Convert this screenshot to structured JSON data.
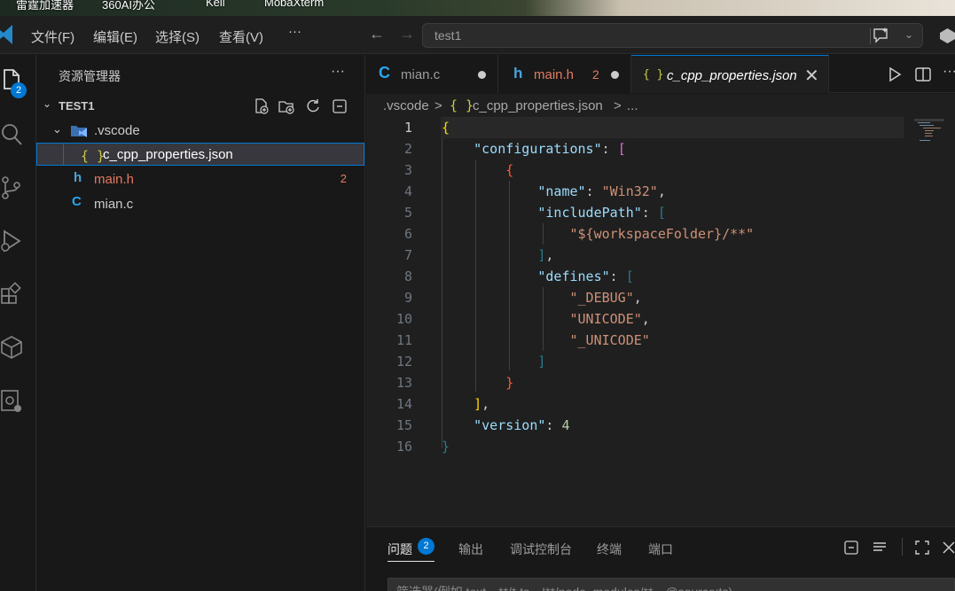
{
  "desktop": {
    "icons": [
      "雷霆加速器",
      "360AI办公",
      "Keil",
      "MobaXterm"
    ]
  },
  "menu": {
    "items": [
      "文件(F)",
      "编辑(E)",
      "选择(S)",
      "查看(V)",
      "···"
    ]
  },
  "command_center": {
    "text": "test1"
  },
  "activity_bar": {
    "explorer_badge": "2",
    "icons": [
      "files-icon",
      "search-icon",
      "source-control-icon",
      "run-debug-icon",
      "extensions-icon",
      "remote-explorer-icon",
      "settings-sync-icon"
    ]
  },
  "sidebar": {
    "title": "资源管理器",
    "more": "···",
    "section": "TEST1",
    "tree": [
      {
        "icon": "vscode-folder-icon",
        "label": ".vscode",
        "expanded": true
      },
      {
        "icon": "json-icon",
        "glyph": "{ }",
        "label": "c_cpp_properties.json",
        "selected": true
      },
      {
        "icon": "h-file-icon",
        "glyph": "h",
        "label": "main.h",
        "problems": "2"
      },
      {
        "icon": "c-file-icon",
        "glyph": "C",
        "label": "mian.c"
      }
    ]
  },
  "tabs": [
    {
      "glyph": "C",
      "label": "mian.c",
      "dirty": true
    },
    {
      "glyph": "h",
      "label": "main.h",
      "problems": "2",
      "dirty": true
    },
    {
      "glyph": "{ }",
      "label": "c_cpp_properties.json",
      "active": true,
      "close": "✕"
    }
  ],
  "breadcrumb": {
    "parts": [
      ".vscode",
      ">",
      "{ }",
      "c_cpp_properties.json",
      ">",
      "..."
    ]
  },
  "editor": {
    "line_numbers": [
      "1",
      "2",
      "3",
      "4",
      "5",
      "6",
      "7",
      "8",
      "9",
      "10",
      "11",
      "12",
      "13",
      "14",
      "15",
      "16"
    ],
    "current_line": 1
  },
  "panel": {
    "tabs": [
      "问题",
      "输出",
      "调试控制台",
      "终端",
      "端口"
    ],
    "problems_badge": "2",
    "filter_placeholder": "筛选器(例如 text、**/*.ts、!**/node_modules/**、@source:ts)"
  },
  "colors": {
    "accent": "#0078d4",
    "error": "#e37a62",
    "json_icon": "#cbcb41",
    "c_icon": "#2aa5ee"
  }
}
